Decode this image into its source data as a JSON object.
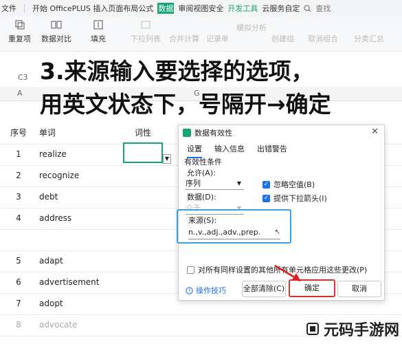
{
  "menubar": {
    "file": "文件",
    "items_pre": "开始 OfficePLUS 插入页面布局公式",
    "highlight": "数据",
    "items_mid": "审阅视图安全",
    "dev": "开发工具",
    "cloud": "云服务自定",
    "search": "查找"
  },
  "ribbon": {
    "btn1": "重复项",
    "btn2": "数据对比",
    "btn3": "填充",
    "btn4": "下拉列表",
    "btn5": "合并计算",
    "btn6": "记录单",
    "btn7": "创建组",
    "btn8": "取消组合",
    "btn9": "分类汇总",
    "btn10": "模拟分析"
  },
  "formulabar": {
    "cellref": "C3"
  },
  "colhdr": {
    "a": "A",
    "g": "G"
  },
  "overlay": {
    "line1": "3.来源输入要选择的选项，",
    "line2": "用英文状态下，号隔开→确定"
  },
  "sheet": {
    "header": {
      "num": "序号",
      "word": "单词",
      "pos": "词性"
    },
    "rows": [
      {
        "num": "1",
        "word": "realize"
      },
      {
        "num": "2",
        "word": "recognize"
      },
      {
        "num": "3",
        "word": "debt"
      },
      {
        "num": "4",
        "word": "address"
      },
      {
        "num": "",
        "word": ""
      },
      {
        "num": "5",
        "word": "adapt"
      },
      {
        "num": "6",
        "word": "advertisement"
      },
      {
        "num": "7",
        "word": "adopt"
      },
      {
        "num": "8",
        "word": "advocate"
      }
    ]
  },
  "dialog": {
    "title": "数据有效性",
    "tabs": [
      "设置",
      "输入信息",
      "出错警告"
    ],
    "section": "有效性条件",
    "allow_label": "允许(A):",
    "allow_value": "序列",
    "data_label": "数据(D):",
    "data_value": "介于",
    "ignore_blank": "忽略空值(B)",
    "dropdown_arrow": "提供下拉箭头(I)",
    "source_label": "来源(S):",
    "source_value": "n.,v.,adj.,adv.,prep.",
    "apply_all": "对所有同样设置的其他所有单元格应用这些更改(P)",
    "tip": "操作技巧",
    "clear_all": "全部清除(C)",
    "ok": "确定",
    "cancel": "取消"
  },
  "watermark": {
    "text": "元码手游网"
  }
}
